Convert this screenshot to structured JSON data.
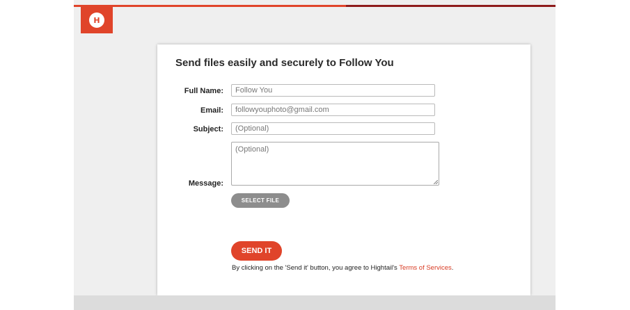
{
  "brand": {
    "logo_letter": "H",
    "accent_color": "#e0442a",
    "dark_accent_color": "#8e1b1b"
  },
  "form": {
    "title": "Send files easily and securely to Follow You",
    "full_name": {
      "label": "Full Name:",
      "value": "Follow You"
    },
    "email": {
      "label": "Email:",
      "value": "followyouphoto@gmail.com"
    },
    "subject": {
      "label": "Subject:",
      "placeholder": "(Optional)"
    },
    "message": {
      "label": "Message:",
      "placeholder": "(Optional)"
    },
    "select_file_label": "SELECT FILE",
    "send_label": "SEND IT",
    "terms_prefix": "By clicking on the 'Send it' button, you agree to Hightail's ",
    "terms_link": "Terms of Services",
    "terms_suffix": "."
  }
}
